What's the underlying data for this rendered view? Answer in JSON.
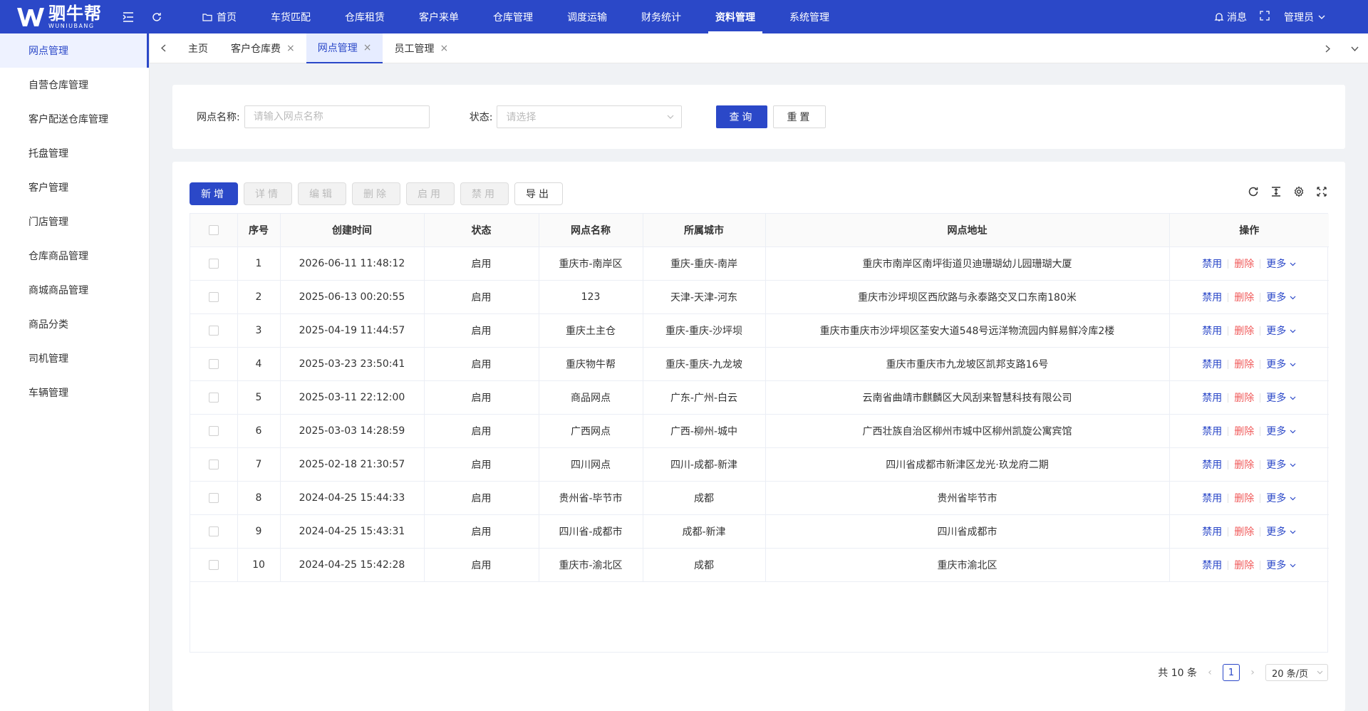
{
  "app": {
    "logo_cn": "驷牛帮",
    "logo_en": "WUNIUBANG",
    "brand_color": "#2b48c8"
  },
  "topnav": {
    "items": [
      {
        "label": "首页",
        "icon": "folder-icon"
      },
      {
        "label": "车货匹配"
      },
      {
        "label": "仓库租赁"
      },
      {
        "label": "客户来单"
      },
      {
        "label": "仓库管理"
      },
      {
        "label": "调度运输"
      },
      {
        "label": "财务统计"
      },
      {
        "label": "资料管理",
        "active": true
      },
      {
        "label": "系统管理"
      }
    ],
    "message": "消息",
    "user": "管理员"
  },
  "sidebar": {
    "items": [
      {
        "label": "网点管理",
        "active": true
      },
      {
        "label": "自营仓库管理"
      },
      {
        "label": "客户配送仓库管理"
      },
      {
        "label": "托盘管理"
      },
      {
        "label": "客户管理"
      },
      {
        "label": "门店管理"
      },
      {
        "label": "仓库商品管理"
      },
      {
        "label": "商城商品管理"
      },
      {
        "label": "商品分类"
      },
      {
        "label": "司机管理"
      },
      {
        "label": "车辆管理"
      }
    ]
  },
  "tabs": [
    {
      "label": "主页",
      "closable": false
    },
    {
      "label": "客户仓库费",
      "closable": true
    },
    {
      "label": "网点管理",
      "closable": true,
      "active": true
    },
    {
      "label": "员工管理",
      "closable": true
    }
  ],
  "filter": {
    "name_label": "网点名称:",
    "name_placeholder": "请输入网点名称",
    "status_label": "状态:",
    "status_placeholder": "请选择",
    "query_label": "查询",
    "reset_label": "重置"
  },
  "toolbar": {
    "add": "新增",
    "detail": "详情",
    "edit": "编辑",
    "delete": "删除",
    "enable": "启用",
    "disable": "禁用",
    "export": "导出"
  },
  "table": {
    "columns": [
      "序号",
      "创建时间",
      "状态",
      "网点名称",
      "所属城市",
      "网点地址",
      "操作"
    ],
    "rows": [
      {
        "no": "1",
        "created": "2026-06-11 11:48:12",
        "status": "启用",
        "name": "重庆市-南岸区",
        "city": "重庆-重庆-南岸",
        "address": "重庆市南岸区南坪街道贝迪珊瑚幼儿园珊瑚大厦"
      },
      {
        "no": "2",
        "created": "2025-06-13 00:20:55",
        "status": "启用",
        "name": "123",
        "city": "天津-天津-河东",
        "address": "重庆市沙坪坝区西欣路与永泰路交叉口东南180米"
      },
      {
        "no": "3",
        "created": "2025-04-19 11:44:57",
        "status": "启用",
        "name": "重庆土主仓",
        "city": "重庆-重庆-沙坪坝",
        "address": "重庆市重庆市沙坪坝区荃安大道548号远洋物流园内鲜易鲜冷库2楼"
      },
      {
        "no": "4",
        "created": "2025-03-23 23:50:41",
        "status": "启用",
        "name": "重庆物牛帮",
        "city": "重庆-重庆-九龙坡",
        "address": "重庆市重庆市九龙坡区凯邦支路16号"
      },
      {
        "no": "5",
        "created": "2025-03-11 22:12:00",
        "status": "启用",
        "name": "商品网点",
        "city": "广东-广州-白云",
        "address": "云南省曲靖市麒麟区大风刮来智慧科技有限公司"
      },
      {
        "no": "6",
        "created": "2025-03-03 14:28:59",
        "status": "启用",
        "name": "广西网点",
        "city": "广西-柳州-城中",
        "address": "广西壮族自治区柳州市城中区柳州凯旋公寓宾馆"
      },
      {
        "no": "7",
        "created": "2025-02-18 21:30:57",
        "status": "启用",
        "name": "四川网点",
        "city": "四川-成都-新津",
        "address": "四川省成都市新津区龙光·玖龙府二期"
      },
      {
        "no": "8",
        "created": "2024-04-25 15:44:33",
        "status": "启用",
        "name": "贵州省-毕节市",
        "city": "成都",
        "address": "贵州省毕节市"
      },
      {
        "no": "9",
        "created": "2024-04-25 15:43:31",
        "status": "启用",
        "name": "四川省-成都市",
        "city": "成都-新津",
        "address": "四川省成都市"
      },
      {
        "no": "10",
        "created": "2024-04-25 15:42:28",
        "status": "启用",
        "name": "重庆市-渝北区",
        "city": "成都",
        "address": "重庆市渝北区"
      }
    ],
    "actions": {
      "disable": "禁用",
      "delete": "删除",
      "more": "更多"
    }
  },
  "pagination": {
    "total": "共 10 条",
    "current": "1",
    "page_size": "20 条/页"
  }
}
